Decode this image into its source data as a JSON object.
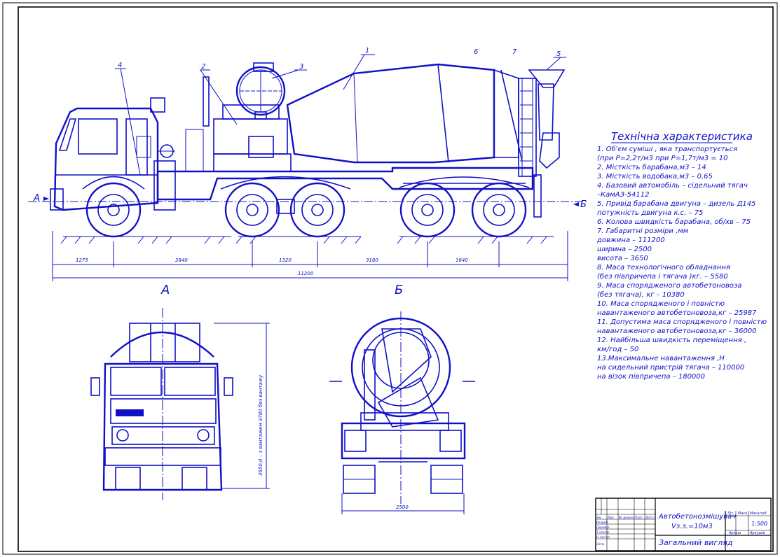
{
  "spec": {
    "title": "Технічна характеристика",
    "lines": [
      "1. Об'єм суміші , яка транспортується",
      "(при P=2,2т/м3 при P=1,7т/м3 = 10",
      "2. Місткість барабана,м3 – 14",
      "3. Місткість водобака,м3 – 0,65",
      "4. Базовий автомобіль – сідельний тягач",
      "   –КамАЗ-54112",
      "5.  Привід барабана двигуна – дизель Д145",
      "   потужність двигуна к.с. – 75",
      "6. Колова швидкість барабана, об/хв – 75",
      "7. Габаритні розміри ,мм",
      "   довжина – 111200",
      "   ширина – 2500",
      "   висота – 3650",
      "8. Маса технологічного обладнання",
      "   (без півпричепа і тягача )кг. – 5580",
      "9. Маса спорядженого автобетоновоза",
      "   (без тягача), кг – 10380",
      "10. Маса спорядженого і повністю",
      "   навантаженого автобетоновоза,кг – 25987",
      "11. Допустима маса спорядженого і повністю",
      "   навантаженого автобетоновоза,кг – 36000",
      "12. Найбільша швидкість переміщення ,",
      "   км/год – 50",
      "13.Максимальне навантаження ,Н",
      "   на сидельний пристрій тягача – 110000",
      "   на візок півпричепа – 180000"
    ]
  },
  "callouts": [
    "1",
    "2",
    "3",
    "4",
    "5",
    "6",
    "7"
  ],
  "section_marks": {
    "a_left": "А",
    "b_right": "Б",
    "view_a": "А",
    "view_b": "Б"
  },
  "dims": {
    "d1": "1275",
    "d2": "2840",
    "d3": "1320",
    "d4": "3180",
    "d5": "1640",
    "total": "11200",
    "height": "3650,0 – з вантажем   3780 без вантажу",
    "rear_width": "2500"
  },
  "title_block": {
    "name": "Автобетонозмішувач",
    "volume": "Vз.з.=10м3",
    "view": "Загальний вигляд",
    "scale": "1:500",
    "cols": [
      "Зм.",
      "Арк.",
      "№ докум.",
      "Підп.",
      "Дата"
    ],
    "rows": [
      "Розроб.",
      "Перевір.",
      "Т.контр.",
      "Н.контр.",
      "Затв."
    ],
    "lit": "Літ.",
    "mass": "Маса",
    "scale_label": "Масштаб",
    "sheet": "Аркуш",
    "sheets": "Аркушів"
  }
}
